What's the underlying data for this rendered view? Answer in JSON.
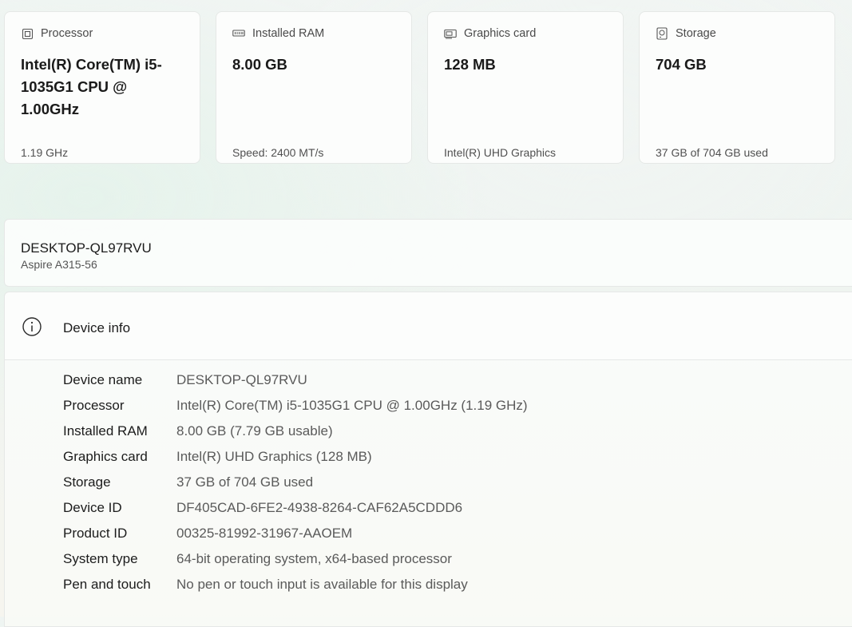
{
  "cards": [
    {
      "icon": "processor-icon",
      "title": "Processor",
      "value": "Intel(R) Core(TM) i5-1035G1 CPU @ 1.00GHz",
      "sub": "1.19 GHz"
    },
    {
      "icon": "ram-icon",
      "title": "Installed RAM",
      "value": "8.00 GB",
      "sub": "Speed: 2400 MT/s"
    },
    {
      "icon": "graphics-card-icon",
      "title": "Graphics card",
      "value": "128 MB",
      "sub": "Intel(R) UHD Graphics"
    },
    {
      "icon": "storage-icon",
      "title": "Storage",
      "value": "704 GB",
      "sub": "37 GB of 704 GB used"
    }
  ],
  "device": {
    "name": "DESKTOP-QL97RVU",
    "model": "Aspire A315-56"
  },
  "device_info": {
    "icon": "info-icon",
    "title": "Device info",
    "rows": [
      {
        "label": "Device name",
        "value": "DESKTOP-QL97RVU"
      },
      {
        "label": "Processor",
        "value": "Intel(R) Core(TM) i5-1035G1 CPU @ 1.00GHz (1.19 GHz)"
      },
      {
        "label": "Installed RAM",
        "value": "8.00 GB (7.79 GB usable)"
      },
      {
        "label": "Graphics card",
        "value": "Intel(R) UHD Graphics (128 MB)"
      },
      {
        "label": "Storage",
        "value": "37 GB of 704 GB used"
      },
      {
        "label": "Device ID",
        "value": "DF405CAD-6FE2-4938-8264-CAF62A5CDDD6"
      },
      {
        "label": "Product ID",
        "value": "00325-81992-31967-AAOEM"
      },
      {
        "label": "System type",
        "value": "64-bit operating system, x64-based processor"
      },
      {
        "label": "Pen and touch",
        "value": "No pen or touch input is available for this display"
      }
    ]
  }
}
